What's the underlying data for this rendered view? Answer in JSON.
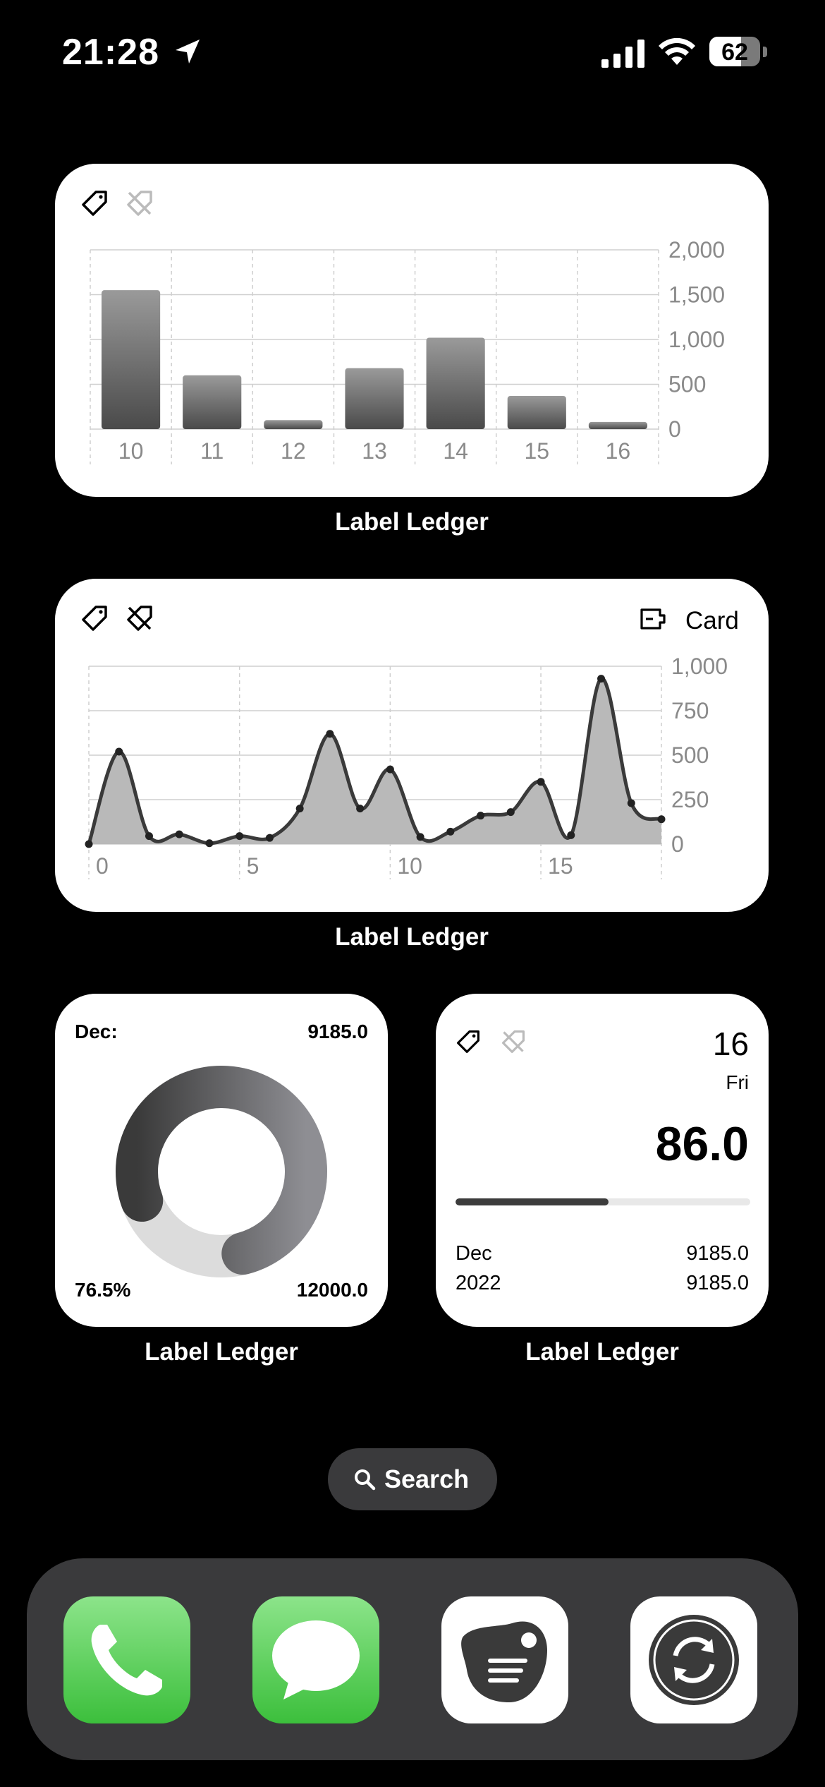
{
  "status_bar": {
    "time": "21:28",
    "battery": "62",
    "battery_level": 0.62
  },
  "widgets": [
    {
      "label": "Label Ledger"
    },
    {
      "label": "Label Ledger",
      "filter_label": "Card"
    },
    {
      "label": "Label Ledger",
      "month_label": "Dec:",
      "month_value": "9185.0",
      "percent": "76.5%",
      "target": "12000.0",
      "progress": 0.765
    },
    {
      "label": "Label Ledger",
      "day": "16",
      "weekday": "Fri",
      "value": "86.0",
      "progress": 0.52,
      "rows": [
        {
          "name": "Dec",
          "value": "9185.0"
        },
        {
          "name": "2022",
          "value": "9185.0"
        }
      ]
    }
  ],
  "search": {
    "label": "Search"
  },
  "dock": {
    "apps": [
      "phone-app",
      "messages-app",
      "label-ledger-app",
      "sync-app"
    ]
  },
  "chart_data": [
    {
      "type": "bar",
      "categories": [
        "10",
        "11",
        "12",
        "13",
        "14",
        "15",
        "16"
      ],
      "values": [
        1550,
        600,
        100,
        680,
        1020,
        370,
        80
      ],
      "ylim": [
        0,
        2000
      ],
      "y_ticks": [
        "0",
        "500",
        "1,000",
        "1,500",
        "2,000"
      ],
      "grid": true
    },
    {
      "type": "area",
      "x": [
        0,
        1,
        2,
        3,
        4,
        5,
        6,
        7,
        8,
        9,
        10,
        11,
        12,
        13,
        14,
        15,
        16,
        17,
        18,
        19
      ],
      "values": [
        0,
        520,
        45,
        55,
        5,
        45,
        35,
        200,
        620,
        200,
        420,
        40,
        70,
        160,
        180,
        350,
        50,
        930,
        230,
        140
      ],
      "xlim": [
        0,
        19
      ],
      "x_ticks": [
        "0",
        "5",
        "10",
        "15"
      ],
      "ylim": [
        0,
        1000
      ],
      "y_ticks": [
        "0",
        "250",
        "500",
        "750",
        "1,000"
      ],
      "grid": true
    }
  ]
}
